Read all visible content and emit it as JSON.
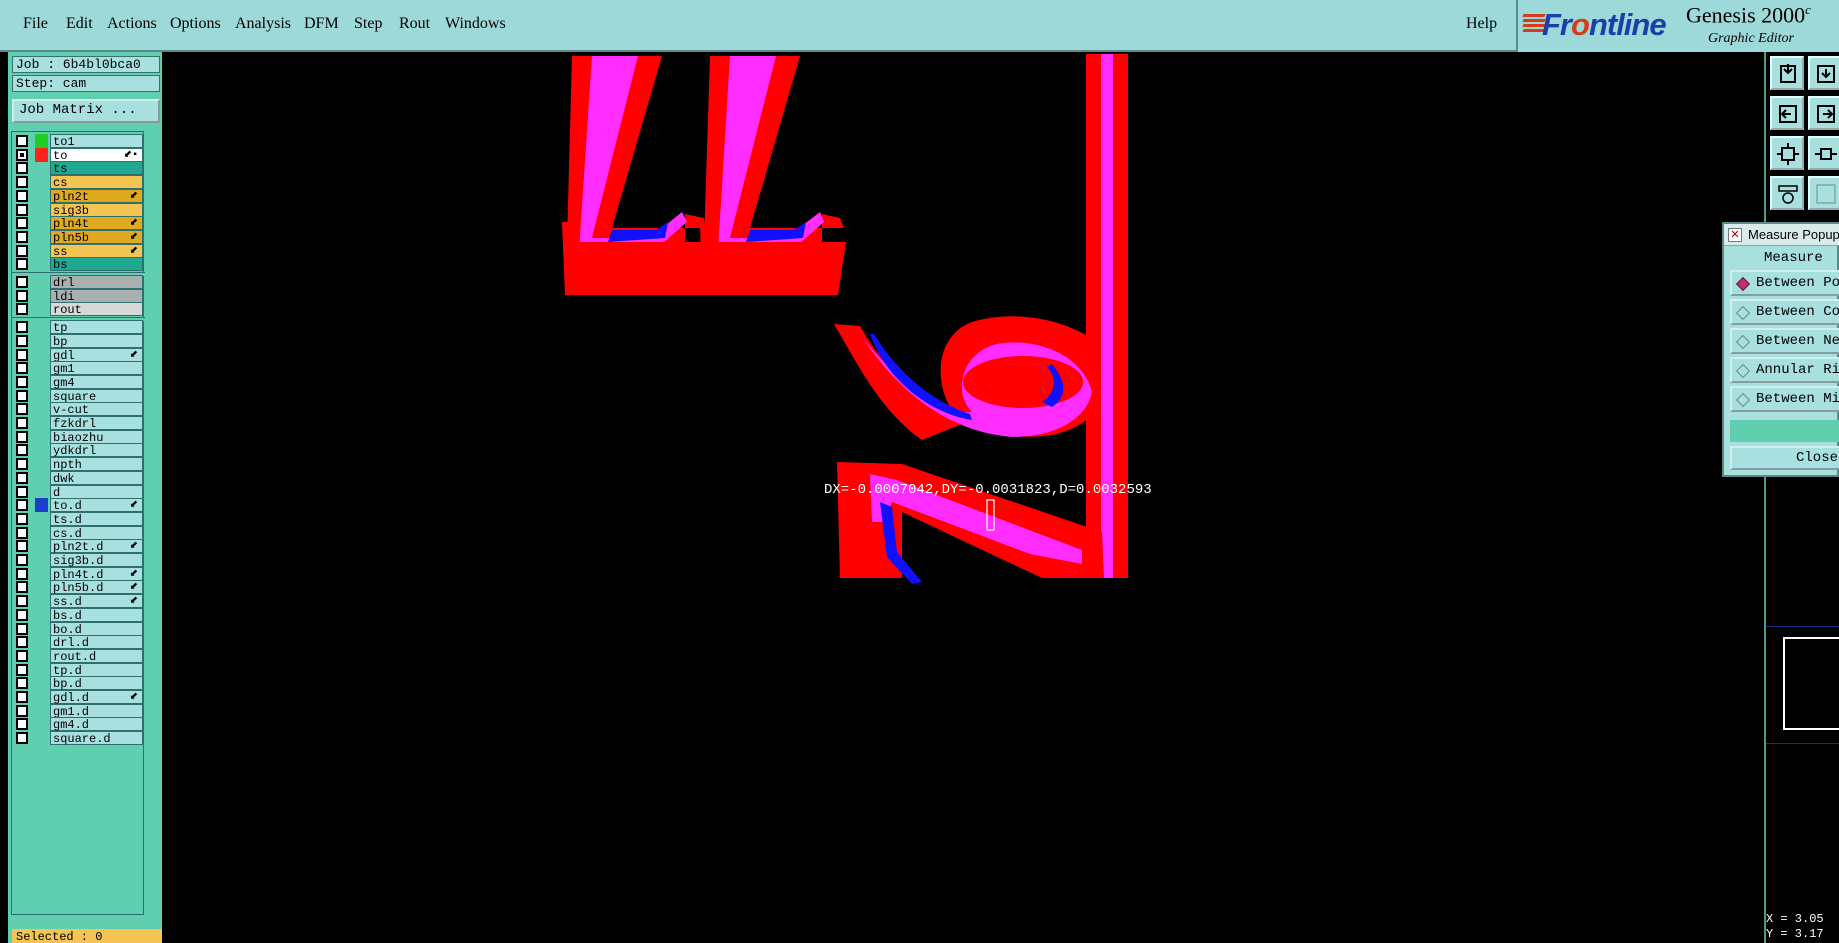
{
  "menu": {
    "items": [
      {
        "label": "File"
      },
      {
        "label": "Edit"
      },
      {
        "label": "Actions"
      },
      {
        "label": "Options"
      },
      {
        "label": "Analysis"
      },
      {
        "label": "DFM"
      },
      {
        "label": "Step"
      },
      {
        "label": "Rout"
      },
      {
        "label": "Windows"
      }
    ],
    "help": "Help"
  },
  "brand": {
    "logo_text_a": "Fr",
    "logo_text_b": "o",
    "logo_text_c": "ntline",
    "product": "Genesis 2000",
    "product_suffix": "c",
    "subtitle": "Graphic Editor",
    "accent_color": "#d83b1a",
    "logo_color": "#1a3fa8"
  },
  "job": {
    "job_label": "Job : 6b4bl0bca0",
    "step_label": "Step: cam",
    "matrix_button": "Job Matrix ..."
  },
  "layers": [
    {
      "name": "to1",
      "color": "#a8e0e0",
      "swatch": "#22cc22",
      "active": false,
      "mark": ""
    },
    {
      "name": "to",
      "color": "#ffffff",
      "swatch": "#ff2020",
      "active": true,
      "mark": "⬋▪"
    },
    {
      "name": "ts",
      "color": "#20a890",
      "swatch": "",
      "active": false,
      "mark": ""
    },
    {
      "name": "cs",
      "color": "#f4c552",
      "swatch": "",
      "active": false,
      "mark": ""
    },
    {
      "name": "pln2t",
      "color": "#e0aa20",
      "swatch": "",
      "active": false,
      "mark": "⬋"
    },
    {
      "name": "sig3b",
      "color": "#f4c552",
      "swatch": "",
      "active": false,
      "mark": ""
    },
    {
      "name": "pln4t",
      "color": "#e0aa20",
      "swatch": "",
      "active": false,
      "mark": "⬋"
    },
    {
      "name": "pln5b",
      "color": "#e0aa20",
      "swatch": "",
      "active": false,
      "mark": "⬋"
    },
    {
      "name": "ss",
      "color": "#f4c552",
      "swatch": "",
      "active": false,
      "mark": "⬋"
    },
    {
      "name": "bs",
      "color": "#20a890",
      "swatch": "",
      "active": false,
      "mark": ""
    },
    {
      "name": "drl",
      "color": "#a8b0b0",
      "swatch": "",
      "active": false,
      "mark": ""
    },
    {
      "name": "ldi",
      "color": "#a8b0b0",
      "swatch": "",
      "active": false,
      "mark": ""
    },
    {
      "name": "rout",
      "color": "#d8d8d8",
      "swatch": "",
      "active": false,
      "mark": ""
    },
    {
      "name": "tp",
      "color": "#a8e0e0",
      "swatch": "",
      "active": false,
      "mark": ""
    },
    {
      "name": "bp",
      "color": "#a8e0e0",
      "swatch": "",
      "active": false,
      "mark": ""
    },
    {
      "name": "gdl",
      "color": "#a8e0e0",
      "swatch": "",
      "active": false,
      "mark": "⬋"
    },
    {
      "name": "gm1",
      "color": "#a8e0e0",
      "swatch": "",
      "active": false,
      "mark": ""
    },
    {
      "name": "gm4",
      "color": "#a8e0e0",
      "swatch": "",
      "active": false,
      "mark": ""
    },
    {
      "name": "square",
      "color": "#a8e0e0",
      "swatch": "",
      "active": false,
      "mark": ""
    },
    {
      "name": "v-cut",
      "color": "#a8e0e0",
      "swatch": "",
      "active": false,
      "mark": ""
    },
    {
      "name": "fzkdrl",
      "color": "#a8e0e0",
      "swatch": "",
      "active": false,
      "mark": ""
    },
    {
      "name": "biaozhu",
      "color": "#a8e0e0",
      "swatch": "",
      "active": false,
      "mark": ""
    },
    {
      "name": "ydkdrl",
      "color": "#a8e0e0",
      "swatch": "",
      "active": false,
      "mark": ""
    },
    {
      "name": "npth",
      "color": "#a8e0e0",
      "swatch": "",
      "active": false,
      "mark": ""
    },
    {
      "name": "dwk",
      "color": "#a8e0e0",
      "swatch": "",
      "active": false,
      "mark": ""
    },
    {
      "name": "d",
      "color": "#a8e0e0",
      "swatch": "",
      "active": false,
      "mark": ""
    },
    {
      "name": "to.d",
      "color": "#a8e0e0",
      "swatch": "#1a3fcc",
      "active": false,
      "mark": "⬋"
    },
    {
      "name": "ts.d",
      "color": "#a8e0e0",
      "swatch": "",
      "active": false,
      "mark": ""
    },
    {
      "name": "cs.d",
      "color": "#a8e0e0",
      "swatch": "",
      "active": false,
      "mark": ""
    },
    {
      "name": "pln2t.d",
      "color": "#a8e0e0",
      "swatch": "",
      "active": false,
      "mark": "⬋"
    },
    {
      "name": "sig3b.d",
      "color": "#a8e0e0",
      "swatch": "",
      "active": false,
      "mark": ""
    },
    {
      "name": "pln4t.d",
      "color": "#a8e0e0",
      "swatch": "",
      "active": false,
      "mark": "⬋"
    },
    {
      "name": "pln5b.d",
      "color": "#a8e0e0",
      "swatch": "",
      "active": false,
      "mark": "⬋"
    },
    {
      "name": "ss.d",
      "color": "#a8e0e0",
      "swatch": "",
      "active": false,
      "mark": "⬋"
    },
    {
      "name": "bs.d",
      "color": "#a8e0e0",
      "swatch": "",
      "active": false,
      "mark": ""
    },
    {
      "name": "bo.d",
      "color": "#a8e0e0",
      "swatch": "",
      "active": false,
      "mark": ""
    },
    {
      "name": "drl.d",
      "color": "#a8e0e0",
      "swatch": "",
      "active": false,
      "mark": ""
    },
    {
      "name": "rout.d",
      "color": "#a8e0e0",
      "swatch": "",
      "active": false,
      "mark": ""
    },
    {
      "name": "tp.d",
      "color": "#a8e0e0",
      "swatch": "",
      "active": false,
      "mark": ""
    },
    {
      "name": "bp.d",
      "color": "#a8e0e0",
      "swatch": "",
      "active": false,
      "mark": ""
    },
    {
      "name": "gdl.d",
      "color": "#a8e0e0",
      "swatch": "",
      "active": false,
      "mark": "⬋"
    },
    {
      "name": "gm1.d",
      "color": "#a8e0e0",
      "swatch": "",
      "active": false,
      "mark": ""
    },
    {
      "name": "gm4.d",
      "color": "#a8e0e0",
      "swatch": "",
      "active": false,
      "mark": ""
    },
    {
      "name": "square.d",
      "color": "#a8e0e0",
      "swatch": "",
      "active": false,
      "mark": ""
    }
  ],
  "status": {
    "selected": "Selected : 0"
  },
  "measure_readout": "DX=-0.0007042,DY=-0.0031823,D=0.0032593",
  "popup": {
    "title": "Measure Popup",
    "header": "Measure",
    "options": [
      {
        "label": "Between Po",
        "selected": true
      },
      {
        "label": "Between Co",
        "selected": false
      },
      {
        "label": "Between Ne",
        "selected": false
      },
      {
        "label": "Annular Ri",
        "selected": false
      },
      {
        "label": "Between Mi",
        "selected": false
      }
    ],
    "close_label": "Close"
  },
  "coords": {
    "x": "X = 3.05",
    "y": "Y = 3.17"
  },
  "canvas_colors": {
    "feature_red": "#ff0000",
    "feature_magenta": "#ff2dff",
    "feature_blue": "#1010ff"
  }
}
